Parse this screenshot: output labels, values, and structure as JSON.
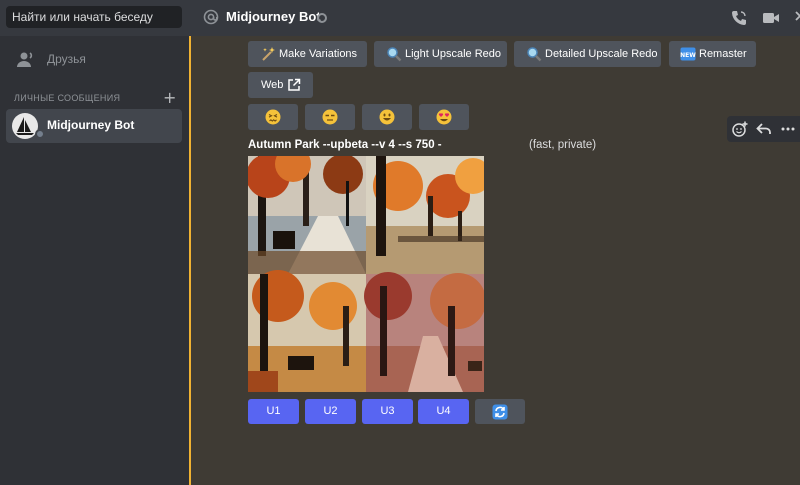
{
  "sidebar": {
    "search_placeholder": "Найти или начать беседу",
    "friends_label": "Друзья",
    "dm_header": "ЛИЧНЫЕ СООБЩЕНИЯ",
    "dm_add": "+",
    "dm_items": [
      {
        "name": "Midjourney Bot"
      }
    ]
  },
  "header": {
    "channel_name": "Midjourney Bot"
  },
  "message": {
    "action_buttons": [
      {
        "label": "Make Variations",
        "icon": "sparkles-icon"
      },
      {
        "label": "Light Upscale Redo",
        "icon": "magnifier-icon"
      },
      {
        "label": "Detailed Upscale Redo",
        "icon": "magnifier-icon"
      },
      {
        "label": "Remaster",
        "icon": "new-badge-icon"
      },
      {
        "label": "Web",
        "icon": "external-link-icon"
      }
    ],
    "reactions": [
      {
        "emoji": "confounded-face"
      },
      {
        "emoji": "unamused-face"
      },
      {
        "emoji": "smiling-face"
      },
      {
        "emoji": "heart-eyes-face"
      }
    ],
    "prompt": "Autumn Park --upbeta --v 4 --s 750 -",
    "meta": "(fast, private)",
    "upscale_buttons": [
      "U1",
      "U2",
      "U3",
      "U4"
    ],
    "rerun_icon": "refresh-icon"
  },
  "colors": {
    "blurple": "#5865f2",
    "accent": "#f0b232",
    "sidebar_bg": "#2f3136",
    "main_bg": "#3f3b34"
  }
}
